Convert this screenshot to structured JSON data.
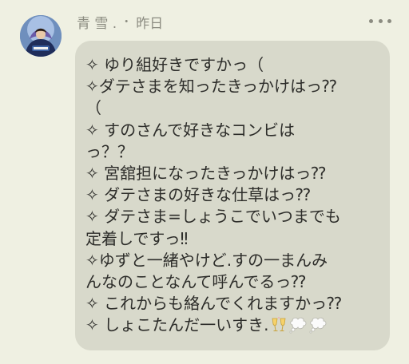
{
  "post": {
    "author": "青 雪 .",
    "separator": "・",
    "time": "昨日",
    "lines": [
      "✧ ゆり組好きですかっ（",
      "✧ダテさまを知ったきっかけはっ⁇",
      "（",
      "✧ すのさんで好きなコンビは",
      "っ？？",
      "✧ 宮舘担になったきっかけはっ⁇",
      "✧ ダテさまの好きな仕草はっ⁇",
      "✧ ダテさま=しょうこでいつまでも",
      "定着しですっ‼",
      "✧ゆずと一緒やけど.すの一まんみ",
      "んなのことなんて呼んでるっ⁇",
      "✧ これからも絡んでくれますかっ⁇",
      "✧ しょこたんだ一いすき."
    ],
    "emojis": [
      "champagne-glasses-emoji",
      "thought-bubble-emoji",
      "thought-bubble-emoji"
    ]
  },
  "colors": {
    "background": "#eff0e2",
    "bubble": "#d8d9cb",
    "text": "#2d2d2a",
    "meta": "#8b8b80"
  }
}
